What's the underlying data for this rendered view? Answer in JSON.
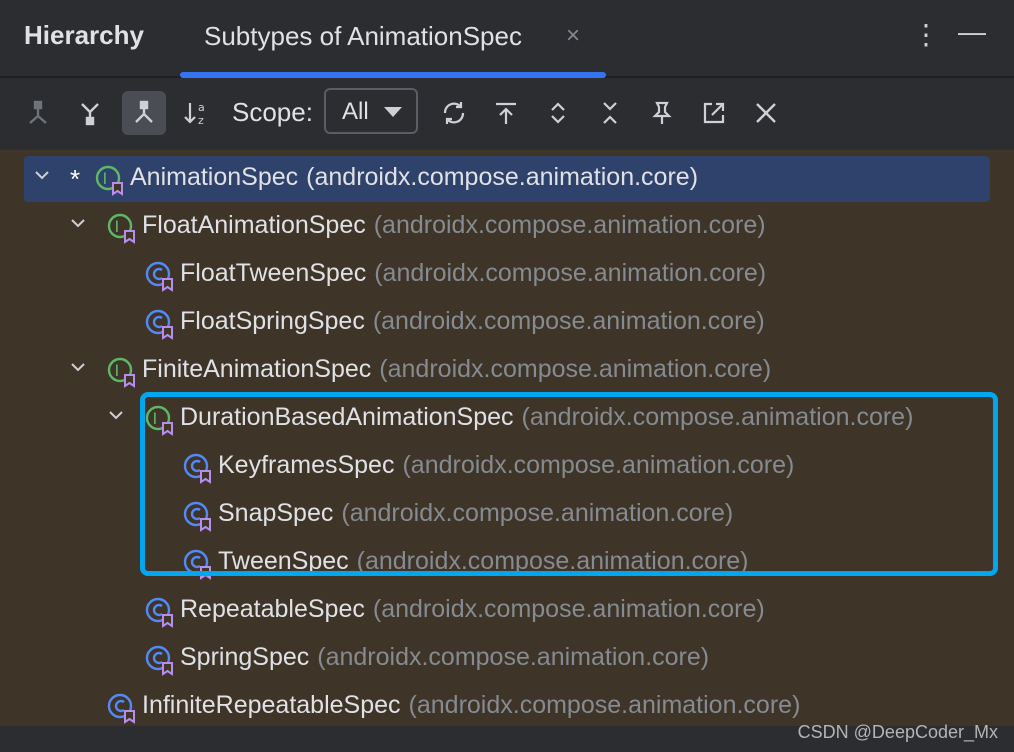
{
  "header": {
    "title": "Hierarchy",
    "tab_label": "Subtypes of AnimationSpec",
    "tab_close": "×",
    "more_glyph": "⋮",
    "minimize_glyph": "—"
  },
  "toolbar": {
    "scope_label": "Scope:",
    "scope_value": "All"
  },
  "colors": {
    "accent": "#3574f0",
    "tree_bg": "#3e3428",
    "selection": "#2f426b",
    "highlight": "#00a7ef",
    "package_text": "#868a91"
  },
  "tree": {
    "rows": [
      {
        "name": "AnimationSpec",
        "pkg": "(androidx.compose.animation.core)",
        "kind": "interface",
        "expanded": true,
        "marker": "*"
      },
      {
        "name": "FloatAnimationSpec",
        "pkg": "(androidx.compose.animation.core)",
        "kind": "interface",
        "expanded": true
      },
      {
        "name": "FloatTweenSpec",
        "pkg": "(androidx.compose.animation.core)",
        "kind": "class"
      },
      {
        "name": "FloatSpringSpec",
        "pkg": "(androidx.compose.animation.core)",
        "kind": "class"
      },
      {
        "name": "FiniteAnimationSpec",
        "pkg": "(androidx.compose.animation.core)",
        "kind": "interface",
        "expanded": true
      },
      {
        "name": "DurationBasedAnimationSpec",
        "pkg": "(androidx.compose.animation.core)",
        "kind": "interface",
        "expanded": true
      },
      {
        "name": "KeyframesSpec",
        "pkg": "(androidx.compose.animation.core)",
        "kind": "class"
      },
      {
        "name": "SnapSpec",
        "pkg": "(androidx.compose.animation.core)",
        "kind": "class"
      },
      {
        "name": "TweenSpec",
        "pkg": "(androidx.compose.animation.core)",
        "kind": "class"
      },
      {
        "name": "RepeatableSpec",
        "pkg": "(androidx.compose.animation.core)",
        "kind": "class"
      },
      {
        "name": "SpringSpec",
        "pkg": "(androidx.compose.animation.core)",
        "kind": "class"
      },
      {
        "name": "InfiniteRepeatableSpec",
        "pkg": "(androidx.compose.animation.core)",
        "kind": "class"
      }
    ]
  },
  "watermark": "CSDN @DeepCoder_Mx"
}
